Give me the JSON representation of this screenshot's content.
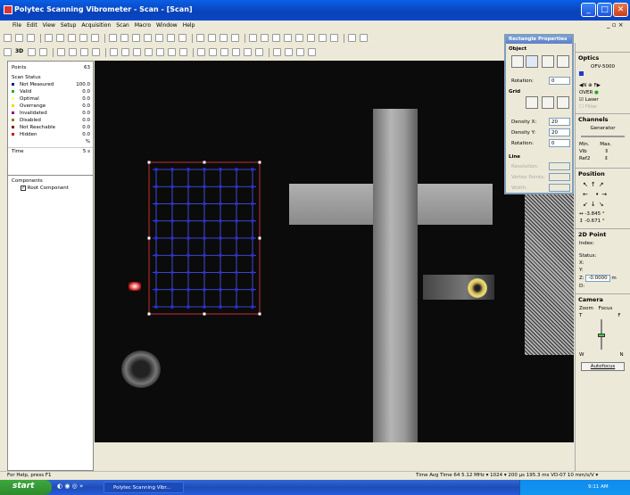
{
  "app_title": "Polytec Scanning Vibrometer - Scan - [Scan]",
  "menu": [
    "File",
    "Edit",
    "View",
    "Setup",
    "Acquisition",
    "Scan",
    "Macro",
    "Window",
    "Help"
  ],
  "toolbar2_labels": {
    "dim3d": "3D"
  },
  "left": {
    "points_label": "Points",
    "points_value": "63",
    "scan_status_label": "Scan Status",
    "status_rows": [
      {
        "label": "Not Measured",
        "value": "100.0",
        "color": "#1a1aa0"
      },
      {
        "label": "Valid",
        "value": "0.0",
        "color": "#22b022"
      },
      {
        "label": "Optimal",
        "value": "0.0",
        "color": "#ffff80"
      },
      {
        "label": "Overrange",
        "value": "0.0",
        "color": "#ffd700"
      },
      {
        "label": "Invalidated",
        "value": "0.0",
        "color": "#8b008b"
      },
      {
        "label": "Disabled",
        "value": "0.0",
        "color": "#808000"
      },
      {
        "label": "Not Reachable",
        "value": "0.0",
        "color": "#8b0000"
      },
      {
        "label": "Hidden",
        "value": "0.0",
        "color": "#d00000"
      }
    ],
    "percent": "%",
    "time_label": "Time",
    "time_value": "5 s",
    "components_label": "Components",
    "root_component": "Root Component"
  },
  "props": {
    "title": "Rectangle Properties",
    "object_label": "Object",
    "rotation_label": "Rotation:",
    "rotation_value": "0",
    "grid_label": "Grid",
    "density_x_label": "Density X:",
    "density_x_value": "20",
    "density_y_label": "Density Y:",
    "density_y_value": "20",
    "grid_rotation_label": "Rotation:",
    "grid_rotation_value": "0",
    "line_label": "Line",
    "resolution_label": "Resolution:",
    "vertex_label": "Vertex Points:",
    "width_label": "Width:"
  },
  "right": {
    "optics_label": "Optics",
    "optics_model": "OFV-5000",
    "over_label": "OVER",
    "laser_label": "Laser",
    "filter_label": "Filter",
    "channels_label": "Channels",
    "generator_label": "Generator",
    "min_label": "Min.",
    "max_label": "Max.",
    "vib_label": "Vib",
    "ref_label": "Ref2",
    "position_label": "Position",
    "pos_x": "-3.845 °",
    "pos_y": "-0.671 °",
    "point2d_label": "2D Point",
    "index_label": "Index:",
    "status_label": "Status:",
    "x_label": "X:",
    "y_label": "Y:",
    "z_label": "Z:",
    "z_value": "-0.0000",
    "z_unit": "m",
    "d_label": "D:",
    "camera_label": "Camera",
    "zoom_label": "Zoom",
    "focus_label": "Focus",
    "t_label": "T",
    "f_label": "F",
    "w_label": "W",
    "n_label": "N",
    "autofocus_label": "Autofocus"
  },
  "status": {
    "help": "For Help, press F1",
    "right": "Time   Avg Time 64   5.12 MHz  ▾   1024  ▾   200 µs  195.3 ms   VD-07 10 mm/s/V  ▾"
  },
  "taskbar": {
    "start": "start",
    "app": "Polytec Scanning Vibr...",
    "clock": "9:11 AM"
  }
}
